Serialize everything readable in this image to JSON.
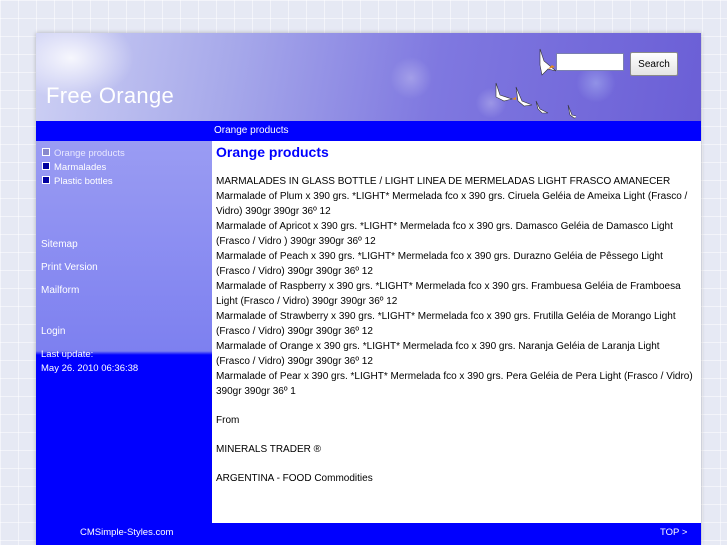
{
  "header": {
    "site_title": "Free Orange",
    "search": {
      "value": "",
      "button_label": "Search"
    }
  },
  "navbar": {
    "breadcrumb": "Orange products"
  },
  "sidebar": {
    "menu": [
      {
        "label": "Orange products",
        "active": true
      },
      {
        "label": "Marmalades",
        "active": false
      },
      {
        "label": "Plastic bottles",
        "active": false
      }
    ],
    "sitemap": "Sitemap",
    "print_version": "Print Version",
    "mailform": "Mailform",
    "login": "Login",
    "last_update_label": "Last update:",
    "last_update_value": "May 26. 2010 06:36:38"
  },
  "content": {
    "title": "Orange products",
    "paragraphs": [
      "MARMALADES IN GLASS BOTTLE / LIGHT  LINEA DE MERMELADAS LIGHT FRASCO AMANECER",
      "Marmalade of Plum x 390 grs. *LIGHT*  Mermelada fco x 390 grs. Ciruela   Geléia de Ameixa Light (Frasco / Vidro)  390gr  390gr  36º  12",
      "Marmalade of Apricot x 390 grs. *LIGHT*  Mermelada fco x 390 grs. Damasco   Geléia de Damasco Light (Frasco / Vidro )  390gr  390gr  36º  12",
      "Marmalade of Peach x 390 grs. *LIGHT*  Mermelada fco x 390 grs. Durazno   Geléia de Pêssego Light (Frasco / Vidro)  390gr  390gr  36º  12",
      "Marmalade of Raspberry x 390 grs. *LIGHT*  Mermelada fco x 390 grs. Frambuesa   Geléia de Framboesa Light (Frasco / Vidro)  390gr  390gr  36º  12",
      "Marmalade  of Strawberry x 390 grs. *LIGHT*  Mermelada fco x 390 grs. Frutilla   Geléia de Morango Light (Frasco / Vidro)  390gr  390gr  36º  12",
      "Marmalade of Orange x 390 grs. *LIGHT*  Mermelada fco x 390 grs. Naranja   Geléia de Laranja Light (Frasco / Vidro)  390gr  390gr  36º  12",
      "Marmalade of Pear x 390 grs. *LIGHT*  Mermelada fco x 390 grs. Pera   Geléia de Pera Light (Frasco / Vidro)  390gr  390gr  36º  1"
    ],
    "from": "From",
    "company": "MINERALS TRADER ®",
    "country": "ARGENTINA - FOOD Commodities"
  },
  "footer": {
    "credit": "CMSimple-Styles.com",
    "top_link": "TOP   >"
  },
  "colors": {
    "accent": "#0000ff",
    "title": "#0000ff",
    "header_gradient_end": "#6b5fd6"
  }
}
